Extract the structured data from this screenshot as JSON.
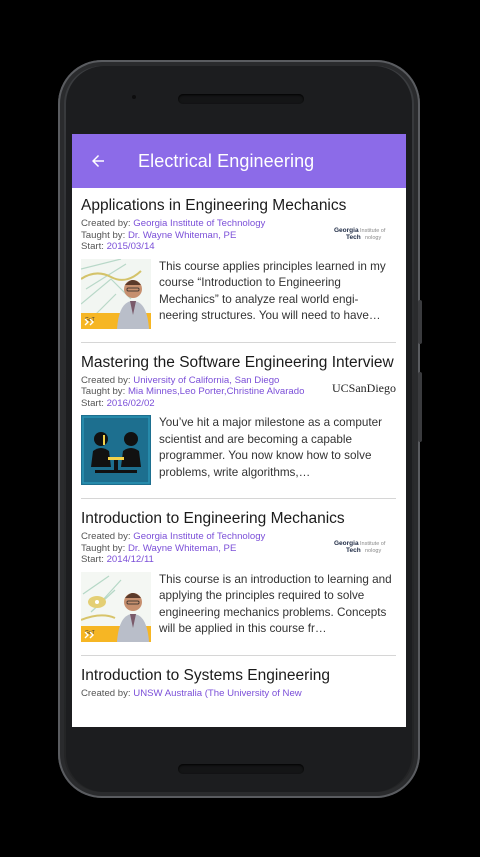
{
  "app": {
    "title": "Electrical Engineering"
  },
  "labels": {
    "created": "Created by: ",
    "taught": "Taught by: ",
    "start": "Start: "
  },
  "courses": [
    {
      "title": "Applications in Engineering Mechanics",
      "created_by": "Georgia Institute of Technology",
      "taught_by": "Dr. Wayne Whiteman, PE",
      "start": "2015/03/14",
      "logo": "georgia-tech-logo",
      "description": "This course applies principles learned in my course “Introduction to Engineering Mechanics” to analyze real world engi-neering structures. You will need to have…"
    },
    {
      "title": "Mastering the Software Engineering Interview",
      "created_by": "University of California, San Diego",
      "taught_by": "Mia Minnes,Leo Porter,Christine Alvarado",
      "start": "2016/02/02",
      "logo_text": "UCSanDiego",
      "description": "You’ve hit a major milestone as a computer scientist and are becoming a capable programmer. You now know how to solve problems, write algorithms,…"
    },
    {
      "title": "Introduction to Engineering Mechanics",
      "created_by": "Georgia Institute of Technology",
      "taught_by": "Dr. Wayne Whiteman, PE",
      "start": "2014/12/11",
      "logo": "georgia-tech-logo",
      "description": "This course is an introduction to learning and applying the principles required to solve engineering mechanics problems. Concepts will be applied in this course fr…"
    },
    {
      "title": "Introduction to Systems Engineering",
      "created_by": "UNSW Australia (The University of New"
    }
  ],
  "colors": {
    "appbar": "#8c6be8",
    "link": "#7b4fd8",
    "frame": "#2a2b2d"
  }
}
